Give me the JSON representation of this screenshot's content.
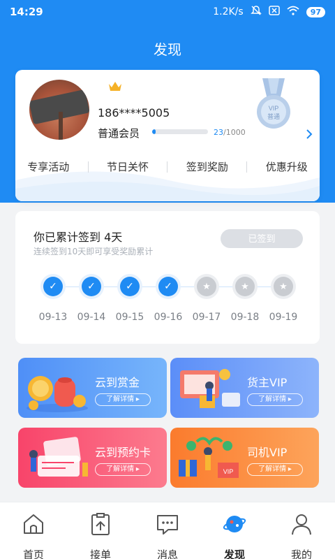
{
  "status_bar": {
    "time": "14:29",
    "speed": "1.2K/s",
    "battery": "97",
    "icons": [
      "mute-icon",
      "sim-off-icon",
      "wifi-icon",
      "battery-icon"
    ]
  },
  "header": {
    "title": "发现"
  },
  "profile": {
    "phone": "186****5005",
    "member_level": "普通会员",
    "progress": {
      "current": "23",
      "total": "/1000",
      "fraction": 0.023
    },
    "medal_text": "VIP",
    "medal_sub": "普通",
    "menu": [
      "专享活动",
      "节日关怀",
      "签到奖励",
      "优惠升级"
    ]
  },
  "signin": {
    "title": "你已累计签到 4天",
    "subtitle": "连续签到10天即可享受奖励累计",
    "button_label": "已签到",
    "days": [
      {
        "date": "09-13",
        "done": true
      },
      {
        "date": "09-14",
        "done": true
      },
      {
        "date": "09-15",
        "done": true
      },
      {
        "date": "09-16",
        "done": true
      },
      {
        "date": "09-17",
        "done": false
      },
      {
        "date": "09-18",
        "done": false
      },
      {
        "date": "09-19",
        "done": false
      }
    ]
  },
  "tiles": [
    {
      "title": "云到赏金",
      "button": "了解详情 ▸"
    },
    {
      "title": "货主VIP",
      "button": "了解详情 ▸"
    },
    {
      "title": "云到预约卡",
      "button": "了解详情 ▸"
    },
    {
      "title": "司机VIP",
      "button": "了解详情 ▸"
    }
  ],
  "nav": {
    "items": [
      {
        "label": "首页",
        "icon": "home-icon"
      },
      {
        "label": "接单",
        "icon": "order-icon"
      },
      {
        "label": "消息",
        "icon": "message-icon"
      },
      {
        "label": "发现",
        "icon": "discover-icon"
      },
      {
        "label": "我的",
        "icon": "profile-icon"
      }
    ],
    "active": "发现"
  },
  "colors": {
    "primary": "#1f8bf3",
    "background": "#f2f3f5"
  }
}
